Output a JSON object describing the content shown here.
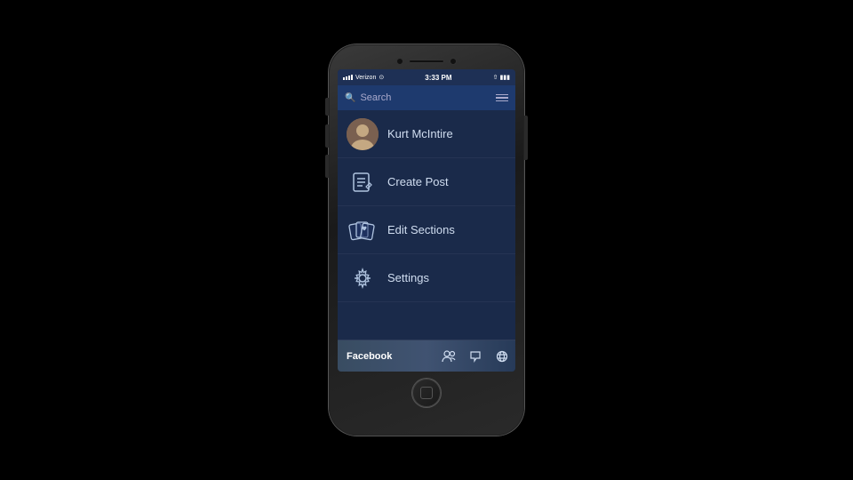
{
  "phone": {
    "status_bar": {
      "carrier": "Verizon",
      "time": "3:33 PM",
      "signal": "wifi"
    },
    "search": {
      "placeholder": "Search"
    },
    "menu_items": [
      {
        "id": "user",
        "label": "Kurt McIntire",
        "icon": "user-avatar"
      },
      {
        "id": "create-post",
        "label": "Create Post",
        "icon": "create-post-icon"
      },
      {
        "id": "edit-sections",
        "label": "Edit Sections",
        "icon": "cards-icon"
      },
      {
        "id": "settings",
        "label": "Settings",
        "icon": "settings-icon"
      }
    ],
    "bottom_bar": {
      "app_label": "Facebook",
      "tab_icons": [
        "friends-icon",
        "messages-icon",
        "globe-icon"
      ]
    }
  }
}
